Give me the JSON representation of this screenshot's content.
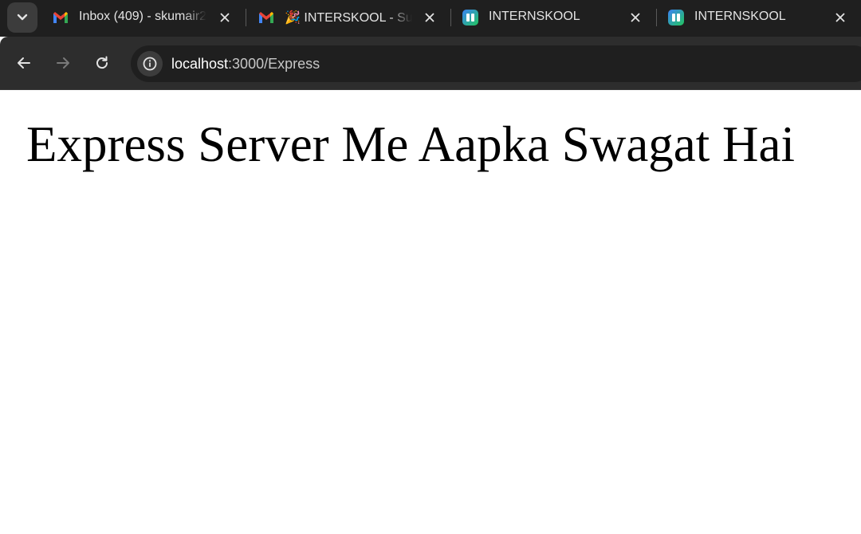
{
  "tabs": [
    {
      "title": "Inbox (409) - skumair2",
      "favicon": "gmail-icon"
    },
    {
      "title": "🎉 INTERSKOOL - Sub",
      "favicon": "gmail-icon"
    },
    {
      "title": "INTERNSKOOL",
      "favicon": "internskool-icon"
    },
    {
      "title": "INTERNSKOOL",
      "favicon": "internskool-icon"
    }
  ],
  "address_bar": {
    "host": "localhost",
    "path": ":3000/Express"
  },
  "page": {
    "heading": "Express Server Me Aapka Swagat Hai"
  },
  "colors": {
    "tabstrip_bg": "#1f1f1f",
    "toolbar_bg": "#2d2d2d",
    "omnibox_bg": "#1f1f1f",
    "page_bg": "#ffffff"
  }
}
